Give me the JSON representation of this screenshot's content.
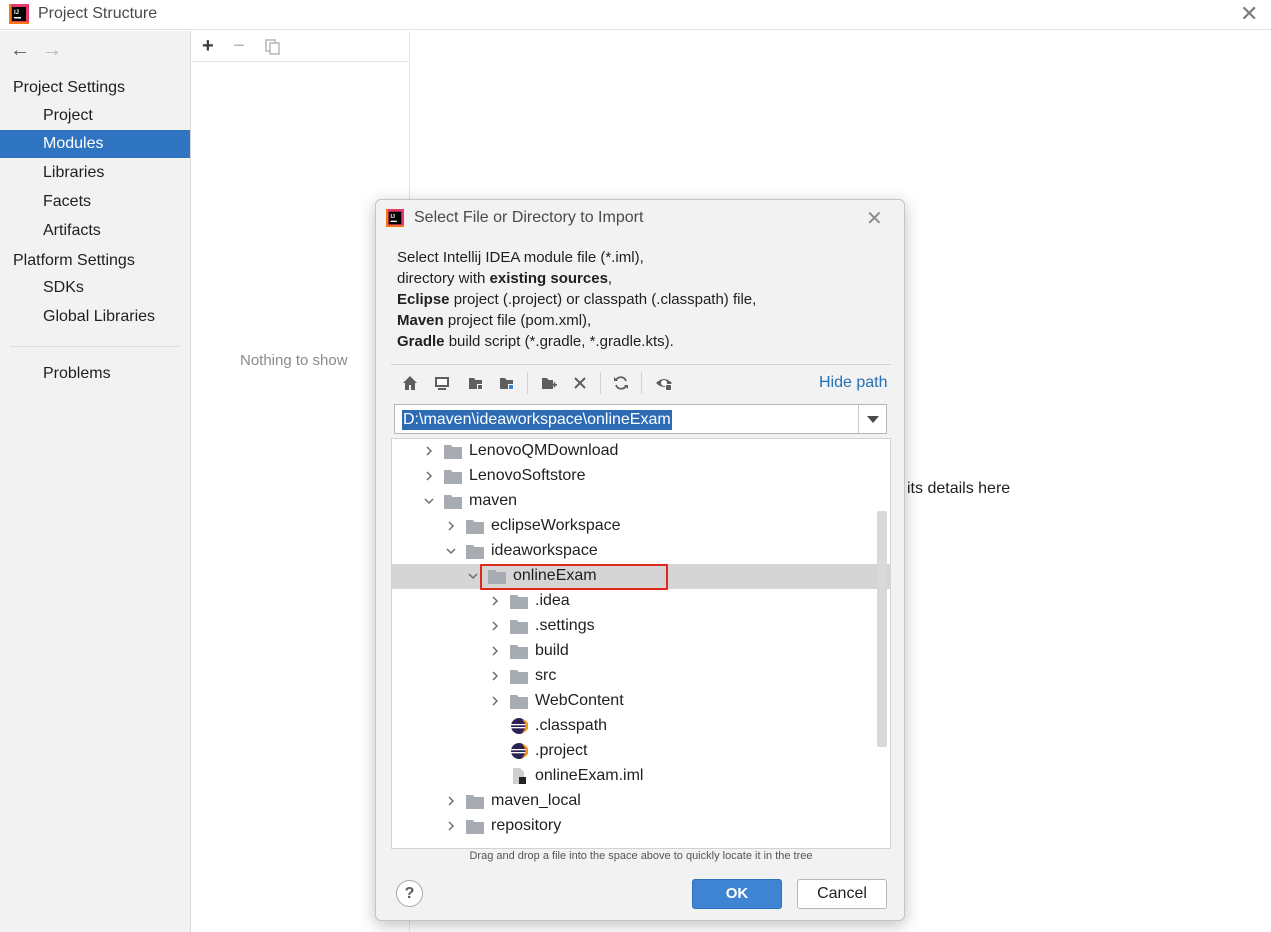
{
  "window": {
    "title": "Project Structure"
  },
  "sidebar": {
    "project_settings_heading": "Project Settings",
    "platform_settings_heading": "Platform Settings",
    "items": [
      {
        "label": "Project",
        "selected": false
      },
      {
        "label": "Modules",
        "selected": true
      },
      {
        "label": "Libraries",
        "selected": false
      },
      {
        "label": "Facets",
        "selected": false
      },
      {
        "label": "Artifacts",
        "selected": false
      },
      {
        "label": "SDKs",
        "selected": false
      },
      {
        "label": "Global Libraries",
        "selected": false
      },
      {
        "label": "Problems",
        "selected": false
      }
    ]
  },
  "module_list": {
    "add": "+",
    "remove": "−",
    "empty_text": "Nothing to show"
  },
  "details": {
    "hint_fragment": "its details here"
  },
  "dialog": {
    "title": "Select File or Directory to Import",
    "description": {
      "line1": "Select Intellij IDEA module file (*.iml),",
      "line2_pre": "directory with ",
      "line2_bold": "existing sources",
      "line2_post": ",",
      "line3_bold": "Eclipse",
      "line3_post": " project (.project) or classpath (.classpath) file,",
      "line4_bold": "Maven",
      "line4_post": " project file (pom.xml),",
      "line5_bold": "Gradle",
      "line5_post": " build script (*.gradle, *.gradle.kts)."
    },
    "toolbar": {
      "icons": [
        "home-icon",
        "desktop-icon",
        "project-folder-icon",
        "module-folder-icon",
        "new-folder-icon",
        "delete-icon",
        "refresh-icon",
        "show-hidden-icon"
      ],
      "hide_path": "Hide path"
    },
    "path": {
      "value": "D:\\maven\\ideaworkspace\\onlineExam"
    },
    "tree": [
      {
        "label": "LenovoQMDownload",
        "level": 0,
        "expandable": true,
        "expanded": false,
        "kind": "folder",
        "selected": false
      },
      {
        "label": "LenovoSoftstore",
        "level": 0,
        "expandable": true,
        "expanded": false,
        "kind": "folder",
        "selected": false
      },
      {
        "label": "maven",
        "level": 0,
        "expandable": true,
        "expanded": true,
        "kind": "folder",
        "selected": false
      },
      {
        "label": "eclipseWorkspace",
        "level": 1,
        "expandable": true,
        "expanded": false,
        "kind": "folder",
        "selected": false
      },
      {
        "label": "ideaworkspace",
        "level": 1,
        "expandable": true,
        "expanded": true,
        "kind": "folder",
        "selected": false
      },
      {
        "label": "onlineExam",
        "level": 2,
        "expandable": true,
        "expanded": true,
        "kind": "folder",
        "selected": true
      },
      {
        "label": ".idea",
        "level": 3,
        "expandable": true,
        "expanded": false,
        "kind": "folder",
        "selected": false
      },
      {
        "label": ".settings",
        "level": 3,
        "expandable": true,
        "expanded": false,
        "kind": "folder",
        "selected": false
      },
      {
        "label": "build",
        "level": 3,
        "expandable": true,
        "expanded": false,
        "kind": "folder",
        "selected": false
      },
      {
        "label": "src",
        "level": 3,
        "expandable": true,
        "expanded": false,
        "kind": "folder",
        "selected": false
      },
      {
        "label": "WebContent",
        "level": 3,
        "expandable": true,
        "expanded": false,
        "kind": "folder",
        "selected": false
      },
      {
        "label": ".classpath",
        "level": 3,
        "expandable": false,
        "expanded": false,
        "kind": "eclipse-file",
        "selected": false
      },
      {
        "label": ".project",
        "level": 3,
        "expandable": false,
        "expanded": false,
        "kind": "eclipse-file",
        "selected": false
      },
      {
        "label": "onlineExam.iml",
        "level": 3,
        "expandable": false,
        "expanded": false,
        "kind": "iml-file",
        "selected": false
      },
      {
        "label": "maven_local",
        "level": 1,
        "expandable": true,
        "expanded": false,
        "kind": "folder",
        "selected": false
      },
      {
        "label": "repository",
        "level": 1,
        "expandable": true,
        "expanded": false,
        "kind": "folder",
        "selected": false
      }
    ],
    "drag_hint": "Drag and drop a file into the space above to quickly locate it in the tree",
    "help": "?",
    "ok": "OK",
    "cancel": "Cancel"
  },
  "colors": {
    "selection": "#2f74c0",
    "highlight_box": "#e0271d",
    "link": "#2470b3",
    "ok_button": "#3f84d2"
  }
}
